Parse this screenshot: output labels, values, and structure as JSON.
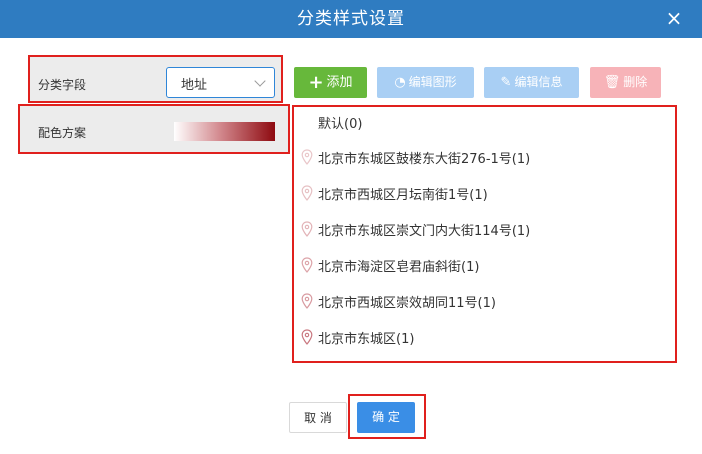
{
  "dialog": {
    "title": "分类样式设置",
    "close_symbol": "×"
  },
  "left_panel": {
    "field_label": "分类字段",
    "field_value": "地址",
    "color_label": "配色方案",
    "gradient_colors": [
      "#ffffff",
      "#d38a8f",
      "#8e0a10"
    ]
  },
  "toolbar": {
    "add": {
      "icon": "plus-icon",
      "label": "添加",
      "color": "#67b83b"
    },
    "edit_shape": {
      "icon": "shape-icon",
      "label": "编辑图形",
      "color": "#a9cff4"
    },
    "edit_info": {
      "icon": "edit-icon",
      "label": "编辑信息",
      "color": "#a9cff4"
    },
    "delete": {
      "icon": "trash-icon",
      "label": "删除",
      "color": "#f7b3b8"
    }
  },
  "list": [
    {
      "text": "默认(0)",
      "pin": false
    },
    {
      "text": "北京市东城区鼓楼东大街276-1号(1)",
      "pin": true
    },
    {
      "text": "北京市西城区月坛南街1号(1)",
      "pin": true
    },
    {
      "text": "北京市东城区崇文门内大街114号(1)",
      "pin": true
    },
    {
      "text": "北京市海淀区皂君庙斜街(1)",
      "pin": true
    },
    {
      "text": "北京市西城区崇效胡同11号(1)",
      "pin": true
    },
    {
      "text": "北京市东城区(1)",
      "pin": true
    }
  ],
  "footer": {
    "cancel": "取 消",
    "ok": "确 定"
  }
}
